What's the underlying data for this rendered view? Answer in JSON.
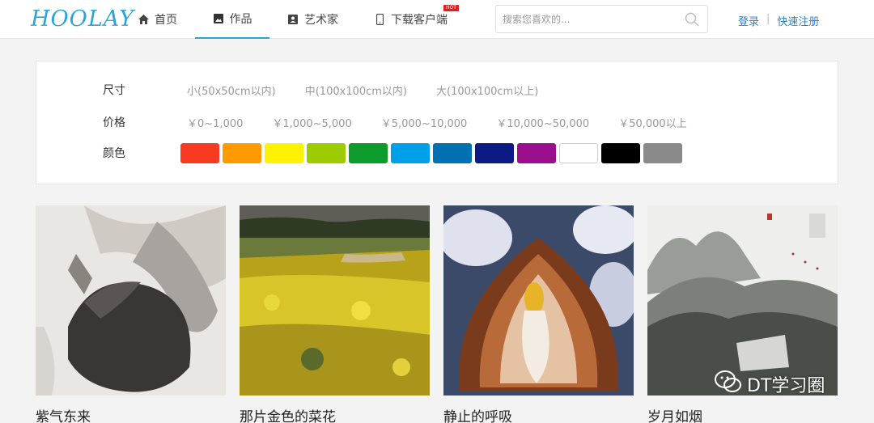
{
  "header": {
    "logo": "HOOLAY",
    "nav": [
      {
        "label": "首页",
        "icon": "home-icon"
      },
      {
        "label": "作品",
        "icon": "image-icon",
        "active": true
      },
      {
        "label": "艺术家",
        "icon": "artist-card-icon"
      },
      {
        "label": "下载客户端",
        "icon": "phone-icon",
        "badge": "HOT"
      }
    ],
    "search": {
      "placeholder": "搜索您喜欢的...",
      "value": ""
    },
    "login": "登录",
    "separator": "|",
    "register": "快速注册"
  },
  "filters": {
    "size": {
      "label": "尺寸",
      "options": [
        "小(50x50cm以内)",
        "中(100x100cm以内)",
        "大(100x100cm以上)"
      ]
    },
    "price": {
      "label": "价格",
      "options": [
        "￥0~1,000",
        "￥1,000~5,000",
        "￥5,000~10,000",
        "￥10,000~50,000",
        "￥50,000以上"
      ]
    },
    "color": {
      "label": "颜色",
      "swatches": [
        "#f83a22",
        "#ff9b00",
        "#fff200",
        "#9ccb00",
        "#0d9b2b",
        "#00a0e9",
        "#0070b0",
        "#0c1b84",
        "#9a0f8e",
        "#ffffff",
        "#000000",
        "#8a8a8a"
      ]
    }
  },
  "artworks": [
    {
      "title": "紫气东来"
    },
    {
      "title": "那片金色的菜花"
    },
    {
      "title": "静止的呼吸"
    },
    {
      "title": "岁月如烟"
    }
  ],
  "watermark": "DT学习圈",
  "colors": {
    "accent": "#2ea3d8",
    "link": "#2e7fc2",
    "badge": "#e02020"
  }
}
